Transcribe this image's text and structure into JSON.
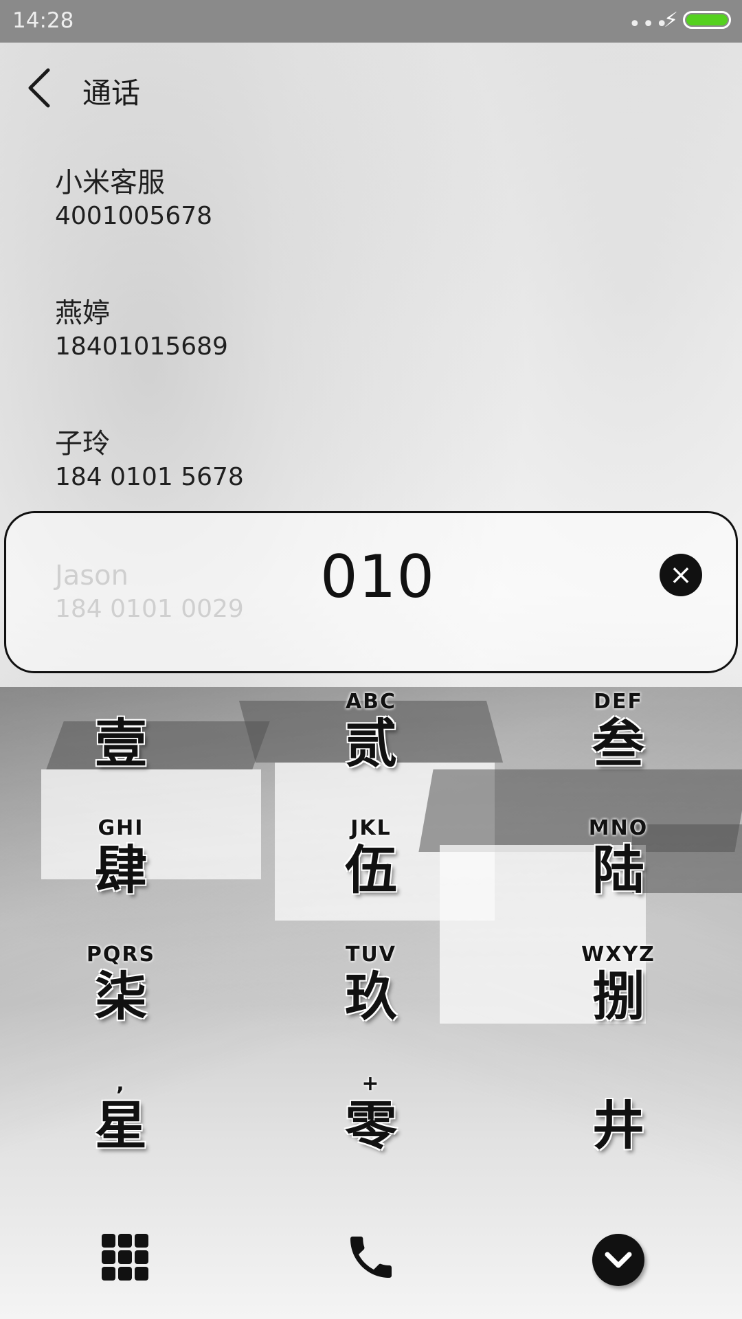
{
  "status_bar": {
    "time": "14:28",
    "dots": "•••",
    "bolt": "⚡"
  },
  "header": {
    "title": "通话"
  },
  "contacts": [
    {
      "name": "小米客服",
      "number": "4001005678"
    },
    {
      "name": "燕婷",
      "number": "18401015689"
    },
    {
      "name": "子玲",
      "number": "184 0101 5678"
    },
    {
      "name": "Jason",
      "number": "184 0101 0029"
    }
  ],
  "dialer": {
    "input_value": "010",
    "clear_symbol": "×"
  },
  "keypad": [
    {
      "main": "壹",
      "sub": ""
    },
    {
      "main": "贰",
      "sub": "ABC"
    },
    {
      "main": "叁",
      "sub": "DEF"
    },
    {
      "main": "肆",
      "sub": "GHI"
    },
    {
      "main": "伍",
      "sub": "JKL"
    },
    {
      "main": "陆",
      "sub": "MNO"
    },
    {
      "main": "柒",
      "sub": "PQRS"
    },
    {
      "main": "玖",
      "sub": "TUV"
    },
    {
      "main": "捌",
      "sub": "WXYZ"
    },
    {
      "main": "星",
      "sub": ","
    },
    {
      "main": "零",
      "sub": "+"
    },
    {
      "main": "井",
      "sub": ""
    }
  ],
  "bottom_actions": {
    "keypad_icon": "grid-icon",
    "call_icon": "phone-icon",
    "collapse_icon": "chevron-down-icon"
  },
  "colors": {
    "status_bar": "#8a8a8a",
    "battery": "#55d11f",
    "text": "#111111"
  }
}
